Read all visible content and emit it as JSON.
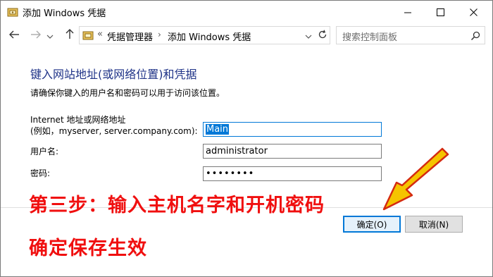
{
  "window": {
    "title": "添加 Windows 凭据",
    "icon": "credential-manager-icon"
  },
  "titlebar_buttons": [
    "minimize-icon",
    "maximize-icon",
    "close-icon"
  ],
  "nav": {
    "back": "back-arrow-icon",
    "forward": "forward-arrow-icon",
    "recent": "chevron-down-icon",
    "up": "up-arrow-icon"
  },
  "address": {
    "prefix": "«",
    "crumbs": [
      "凭据管理器",
      "添加 Windows 凭据"
    ],
    "separator": "›"
  },
  "search": {
    "placeholder": "搜索控制面板"
  },
  "form": {
    "heading": "键入网站地址(或网络位置)和凭据",
    "description": "请确保你键入的用户名和密码可以用于访问该位置。",
    "address_label_line1": "Internet 地址或网络地址",
    "address_label_line2": "(例如，myserver, server.company.com):",
    "address_value": "Main",
    "username_label": "用户名:",
    "username_value": "administrator",
    "password_label": "密码:",
    "password_value": "••••••••"
  },
  "buttons": {
    "ok": "确定(O)",
    "cancel": "取消(N)"
  },
  "annotation": {
    "line1": "第三步：输入主机名字和开机密码",
    "line2": "确定保存生效",
    "color": "#f00f0f",
    "arrow_color": "#f5c400"
  },
  "colors": {
    "heading": "#1e3287",
    "accent": "#0078d7"
  }
}
